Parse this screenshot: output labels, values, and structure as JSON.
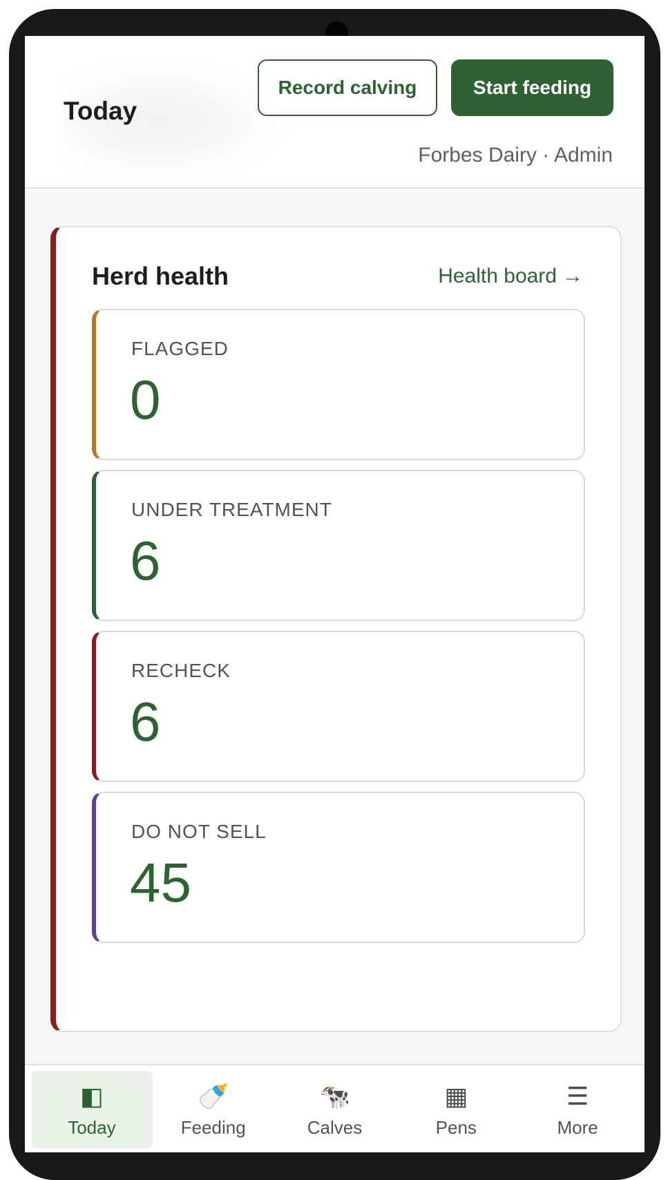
{
  "header": {
    "title": "Today",
    "record_calving_label": "Record calving",
    "start_feeding_label": "Start feeding",
    "org_user": "Forbes Dairy · Admin"
  },
  "herd_health": {
    "title": "Herd health",
    "link_label": "Health board",
    "link_arrow": "→",
    "accent_color": "#8b1c18",
    "stats": [
      {
        "label": "FLAGGED",
        "value": "0",
        "accent": "#b8761e"
      },
      {
        "label": "UNDER TREATMENT",
        "value": "6",
        "accent": "#2f6232"
      },
      {
        "label": "RECHECK",
        "value": "6",
        "accent": "#8b1c18"
      },
      {
        "label": "DO NOT SELL",
        "value": "45",
        "accent": "#5b3f9c"
      }
    ]
  },
  "nav": {
    "items": [
      {
        "label": "Today",
        "icon": "panel-icon",
        "glyph": "◧",
        "active": true
      },
      {
        "label": "Feeding",
        "icon": "baby-bottle-icon",
        "glyph": "🍼",
        "active": false
      },
      {
        "label": "Calves",
        "icon": "cow-icon",
        "glyph": "🐄",
        "active": false
      },
      {
        "label": "Pens",
        "icon": "grid-icon",
        "glyph": "▦",
        "active": false
      },
      {
        "label": "More",
        "icon": "menu-icon",
        "glyph": "☰",
        "active": false
      }
    ]
  },
  "theme": {
    "primary": "#2f6232",
    "text": "#1b1f1c",
    "muted": "#5a605c"
  }
}
